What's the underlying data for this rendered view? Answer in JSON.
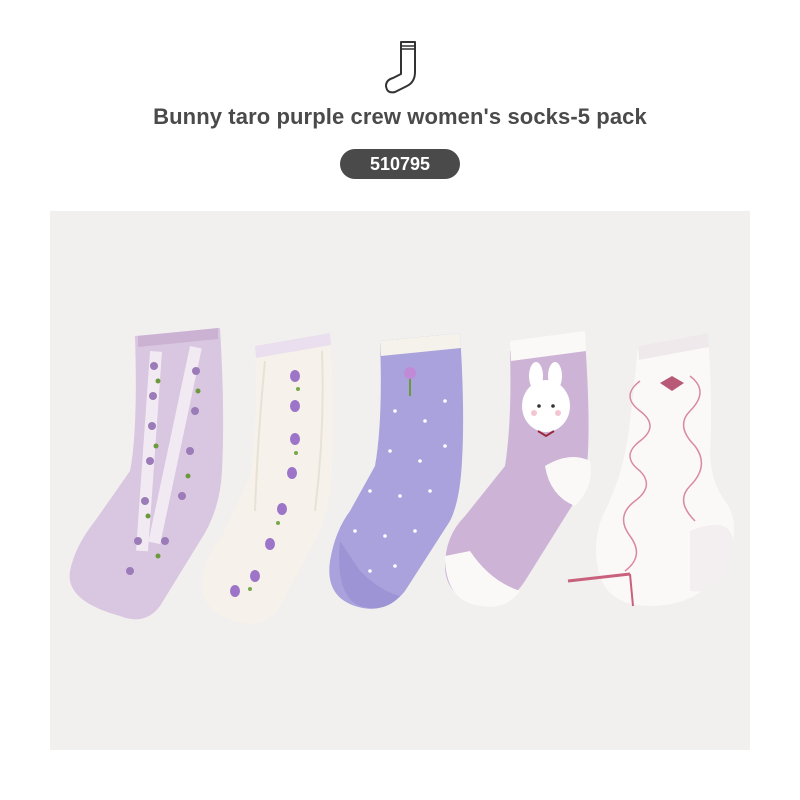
{
  "header": {
    "icon": "sock-outline-icon",
    "title": "Bunny taro purple crew women's socks-5 pack",
    "sku": "510795"
  },
  "photo": {
    "subject": "product-photo-five-socks",
    "colors": {
      "background": "#f1f0ef",
      "lilac": "#d9c6e0",
      "cream": "#f6f1ea",
      "lavender": "#a9a2dc",
      "mauve": "#cdb4d6",
      "white": "#fbf9f8",
      "badge": "#4a4a4a"
    }
  }
}
